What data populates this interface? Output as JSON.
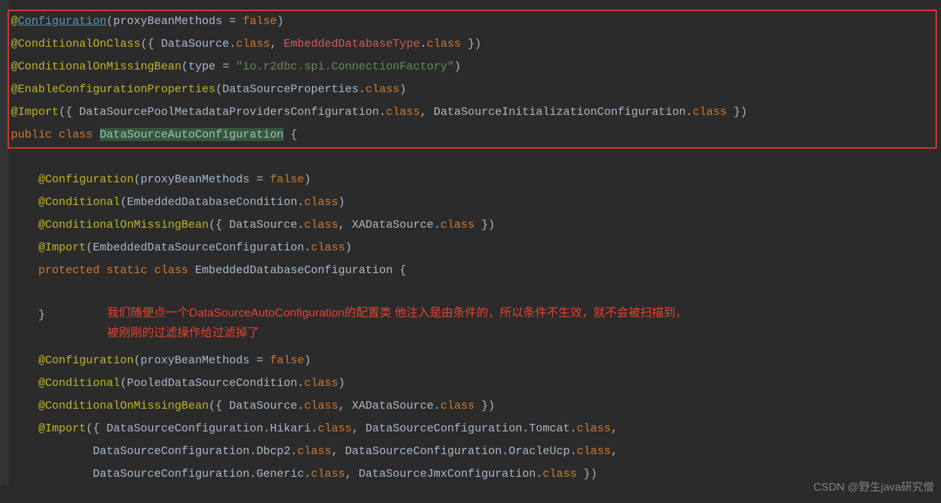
{
  "code": {
    "l1_at": "@",
    "l1_config": "Configuration",
    "l1_rest": "(proxyBeanMethods = ",
    "l1_false": "false",
    "l1_end": ")",
    "l2": "@ConditionalOnClass",
    "l2_rest1": "({ DataSource.",
    "l2_class1": "class",
    "l2_rest2": ", ",
    "l2_embed": "EmbeddedDatabaseType",
    "l2_rest3": ".",
    "l2_class2": "class",
    "l2_rest4": " })",
    "l3": "@ConditionalOnMissingBean",
    "l3_rest1": "(type = ",
    "l3_str": "\"io.r2dbc.spi.ConnectionFactory\"",
    "l3_rest2": ")",
    "l4": "@EnableConfigurationProperties",
    "l4_rest1": "(DataSourceProperties.",
    "l4_class": "class",
    "l4_rest2": ")",
    "l5": "@Import",
    "l5_rest1": "({ DataSourcePoolMetadataProvidersConfiguration.",
    "l5_class1": "class",
    "l5_rest2": ", DataSourceInitializationConfiguration.",
    "l5_class2": "class",
    "l5_rest3": " })",
    "l6_public": "public ",
    "l6_class": "class ",
    "l6_name": "DataSourceAutoConfiguration",
    "l6_rest": " {",
    "b1": "    @Configuration",
    "b1_rest1": "(proxyBeanMethods = ",
    "b1_false": "false",
    "b1_rest2": ")",
    "b2": "    @Conditional",
    "b2_rest1": "(EmbeddedDatabaseCondition.",
    "b2_class": "class",
    "b2_rest2": ")",
    "b3": "    @ConditionalOnMissingBean",
    "b3_rest1": "({ DataSource.",
    "b3_class1": "class",
    "b3_rest2": ", XADataSource.",
    "b3_class2": "class",
    "b3_rest3": " })",
    "b4": "    @Import",
    "b4_rest1": "(EmbeddedDataSourceConfiguration.",
    "b4_class": "class",
    "b4_rest2": ")",
    "b5_prot": "    protected ",
    "b5_static": "static ",
    "b5_class": "class ",
    "b5_name": "EmbeddedDatabaseConfiguration {",
    "b6": "    }",
    "comment1": "我们随便点一个DataSourceAutoConfiguration的配置类 他注入是由条件的，所以条件不生效，就不会被扫描到，",
    "comment2": "被刚刚的过滤操作给过滤掉了",
    "c1": "    @Configuration",
    "c1_rest1": "(proxyBeanMethods = ",
    "c1_false": "false",
    "c1_rest2": ")",
    "c2": "    @Conditional",
    "c2_rest1": "(PooledDataSourceCondition.",
    "c2_class": "class",
    "c2_rest2": ")",
    "c3": "    @ConditionalOnMissingBean",
    "c3_rest1": "({ DataSource.",
    "c3_class1": "class",
    "c3_rest2": ", XADataSource.",
    "c3_class2": "class",
    "c3_rest3": " })",
    "c4": "    @Import",
    "c4_rest1": "({ DataSourceConfiguration.Hikari.",
    "c4_class1": "class",
    "c4_rest2": ", DataSourceConfiguration.Tomcat.",
    "c4_class2": "class",
    "c4_rest3": ",",
    "c5_indent": "            DataSourceConfiguration.Dbcp2.",
    "c5_class1": "class",
    "c5_rest2": ", DataSourceConfiguration.OracleUcp.",
    "c5_class2": "class",
    "c5_rest3": ",",
    "c6_indent": "            DataSourceConfiguration.Generic.",
    "c6_class1": "class",
    "c6_rest2": ", DataSourceJmxConfiguration.",
    "c6_class2": "class",
    "c6_rest3": " })"
  },
  "watermark": "CSDN @野生java研究僧"
}
